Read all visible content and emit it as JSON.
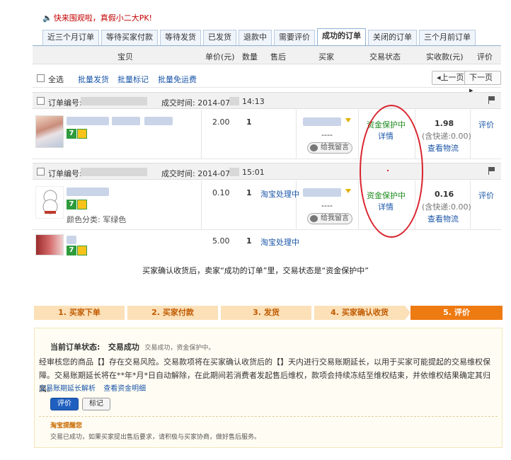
{
  "promo": {
    "text": "快来围观啦，真假小二大PK!"
  },
  "tabs": [
    {
      "label": "近三个月订单"
    },
    {
      "label": "等待买家付款"
    },
    {
      "label": "等待发货"
    },
    {
      "label": "已发货"
    },
    {
      "label": "退款中"
    },
    {
      "label": "需要评价"
    },
    {
      "label": "成功的订单"
    },
    {
      "label": "关闭的订单"
    },
    {
      "label": "三个月前订单"
    }
  ],
  "header": {
    "item": "宝贝",
    "price": "单价(元)",
    "qty": "数量",
    "after_sale": "售后",
    "buyer": "买家",
    "status": "交易状态",
    "paid": "实收款(元)",
    "rate": "评价"
  },
  "actions": {
    "select_all": "全选",
    "batch_ship": "批量发货",
    "batch_mark": "批量标记",
    "batch_free_ship": "批量免运费",
    "prev": "上一页",
    "next": "下一页"
  },
  "orders": [
    {
      "no_label": "订单编号:",
      "time_label": "成交时间: 2014-07",
      "time_tail": "14:13",
      "price": "2.00",
      "qty": "1",
      "buyer_dash": "----",
      "leave_msg": "给我留言",
      "status": "资金保护中",
      "detail": "详情",
      "amount": "1.98",
      "shipping": "(含快递:0.00)",
      "logistics": "查看物流",
      "rate": "评价"
    },
    {
      "no_label": "订单编号:",
      "time_label": "成交时间: 2014-07",
      "time_tail": "15:01",
      "price": "0.10",
      "qty": "1",
      "after_sale": "淘宝处理中",
      "variant": "颜色分类: 军绿色",
      "buyer_dash": "----",
      "leave_msg": "给我留言",
      "status": "资金保护中",
      "detail": "详情",
      "amount": "0.16",
      "shipping": "(含快递:0.00)",
      "logistics": "查看物流",
      "rate": "评价",
      "sub_price": "5.00",
      "sub_qty": "1",
      "sub_after_sale": "淘宝处理中"
    }
  ],
  "caption": "买家确认收货后，卖家“成功的订单”里，交易状态是“资金保护中”",
  "steps": [
    {
      "label": "1. 买家下单"
    },
    {
      "label": "2. 买家付款"
    },
    {
      "label": "3. 发货"
    },
    {
      "label": "4. 买家确认收货"
    },
    {
      "label": "5. 评价"
    }
  ],
  "detail": {
    "state_label": "当前订单状态:",
    "state_value": "交易成功",
    "state_small": "交易成功，资金保护中。",
    "para": "经审核您的商品【】存在交易风险。交易款项将在买家确认收货后的【】天内进行交易账期延长，以用于买家可能提起的交易维权保障。交易账期延长将在**年*月*日自动解除，在此期间若消费者发起售后维权，款项会持续冻结至维权结束，并依维权结果确定其归属。",
    "link1": "交易账期延长解析",
    "link2": "查看资金明细",
    "btn_rate": "评价",
    "btn_mark": "标记",
    "reminder_title": "淘宝提醒您",
    "reminder_text": "交易已成功，如果买家提出售后要求，请积极与买家协商，做好售后服务。"
  },
  "colors": {
    "accent_orange": "#ee7a12",
    "status_green": "#1b8a1b",
    "link_blue": "#1a55a8",
    "ring_red": "#d9232d"
  }
}
